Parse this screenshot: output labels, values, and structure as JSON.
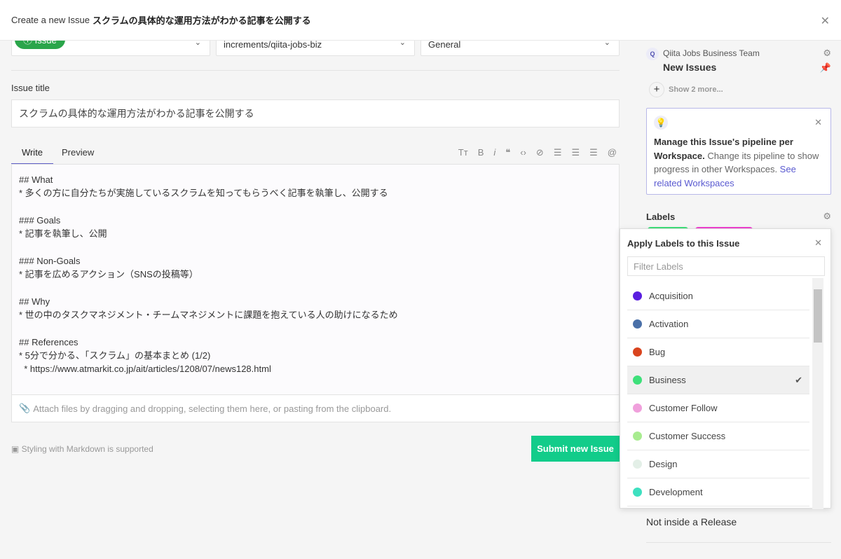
{
  "header": {
    "prefix": "Create a new Issue",
    "title": "スクラムの具体的な運用方法がわかる記事を公開する"
  },
  "selects": {
    "type": "Issue",
    "repo": "increments/qiita-jobs-biz",
    "release": "General"
  },
  "form": {
    "title_label": "Issue title",
    "title_value": "スクラムの具体的な運用方法がわかる記事を公開する",
    "tabs": [
      "Write",
      "Preview"
    ],
    "body": "## What\n* 多くの方に自分たちが実施しているスクラムを知ってもらうべく記事を執筆し、公開する\n\n### Goals\n* 記事を執筆し、公開\n\n### Non-Goals\n* 記事を広めるアクション（SNSの投稿等）\n\n## Why\n* 世の中のタスクマネジメント・チームマネジメントに課題を抱えている人の助けになるため\n\n## References\n* 5分で分かる、「スクラム」の基本まとめ (1/2)\n  * https://www.atmarkit.co.jp/ait/articles/1208/07/news128.html",
    "attach": "Attach files by dragging and dropping, selecting them here, or pasting from the clipboard.",
    "markdown_note": "Styling with Markdown is supported",
    "submit": "Submit new Issue"
  },
  "sidebar": {
    "workspace": "Qiita Jobs Business Team",
    "pipeline": "New Issues",
    "show_more": "Show 2 more...",
    "tip_bold": "Manage this Issue's pipeline per Workspace.",
    "tip_text": " Change its pipeline to show progress in other Workspaces. ",
    "tip_link": "See related Workspaces",
    "labels_heading": "Labels",
    "release_text": "Not inside a Release"
  },
  "label_popup": {
    "title": "Apply Labels to this Issue",
    "filter_placeholder": "Filter Labels",
    "items": [
      {
        "name": "Acquisition",
        "color": "#5a1ee0",
        "checked": false
      },
      {
        "name": "Activation",
        "color": "#4a70a8",
        "checked": false
      },
      {
        "name": "Bug",
        "color": "#d9441e",
        "checked": false
      },
      {
        "name": "Business",
        "color": "#3ee07a",
        "checked": true
      },
      {
        "name": "Customer Follow",
        "color": "#f0a0dc",
        "checked": false
      },
      {
        "name": "Customer Success",
        "color": "#a8ec90",
        "checked": false
      },
      {
        "name": "Design",
        "color": "#e3efe7",
        "checked": false
      },
      {
        "name": "Development",
        "color": "#3ee0c0",
        "checked": false
      }
    ]
  }
}
